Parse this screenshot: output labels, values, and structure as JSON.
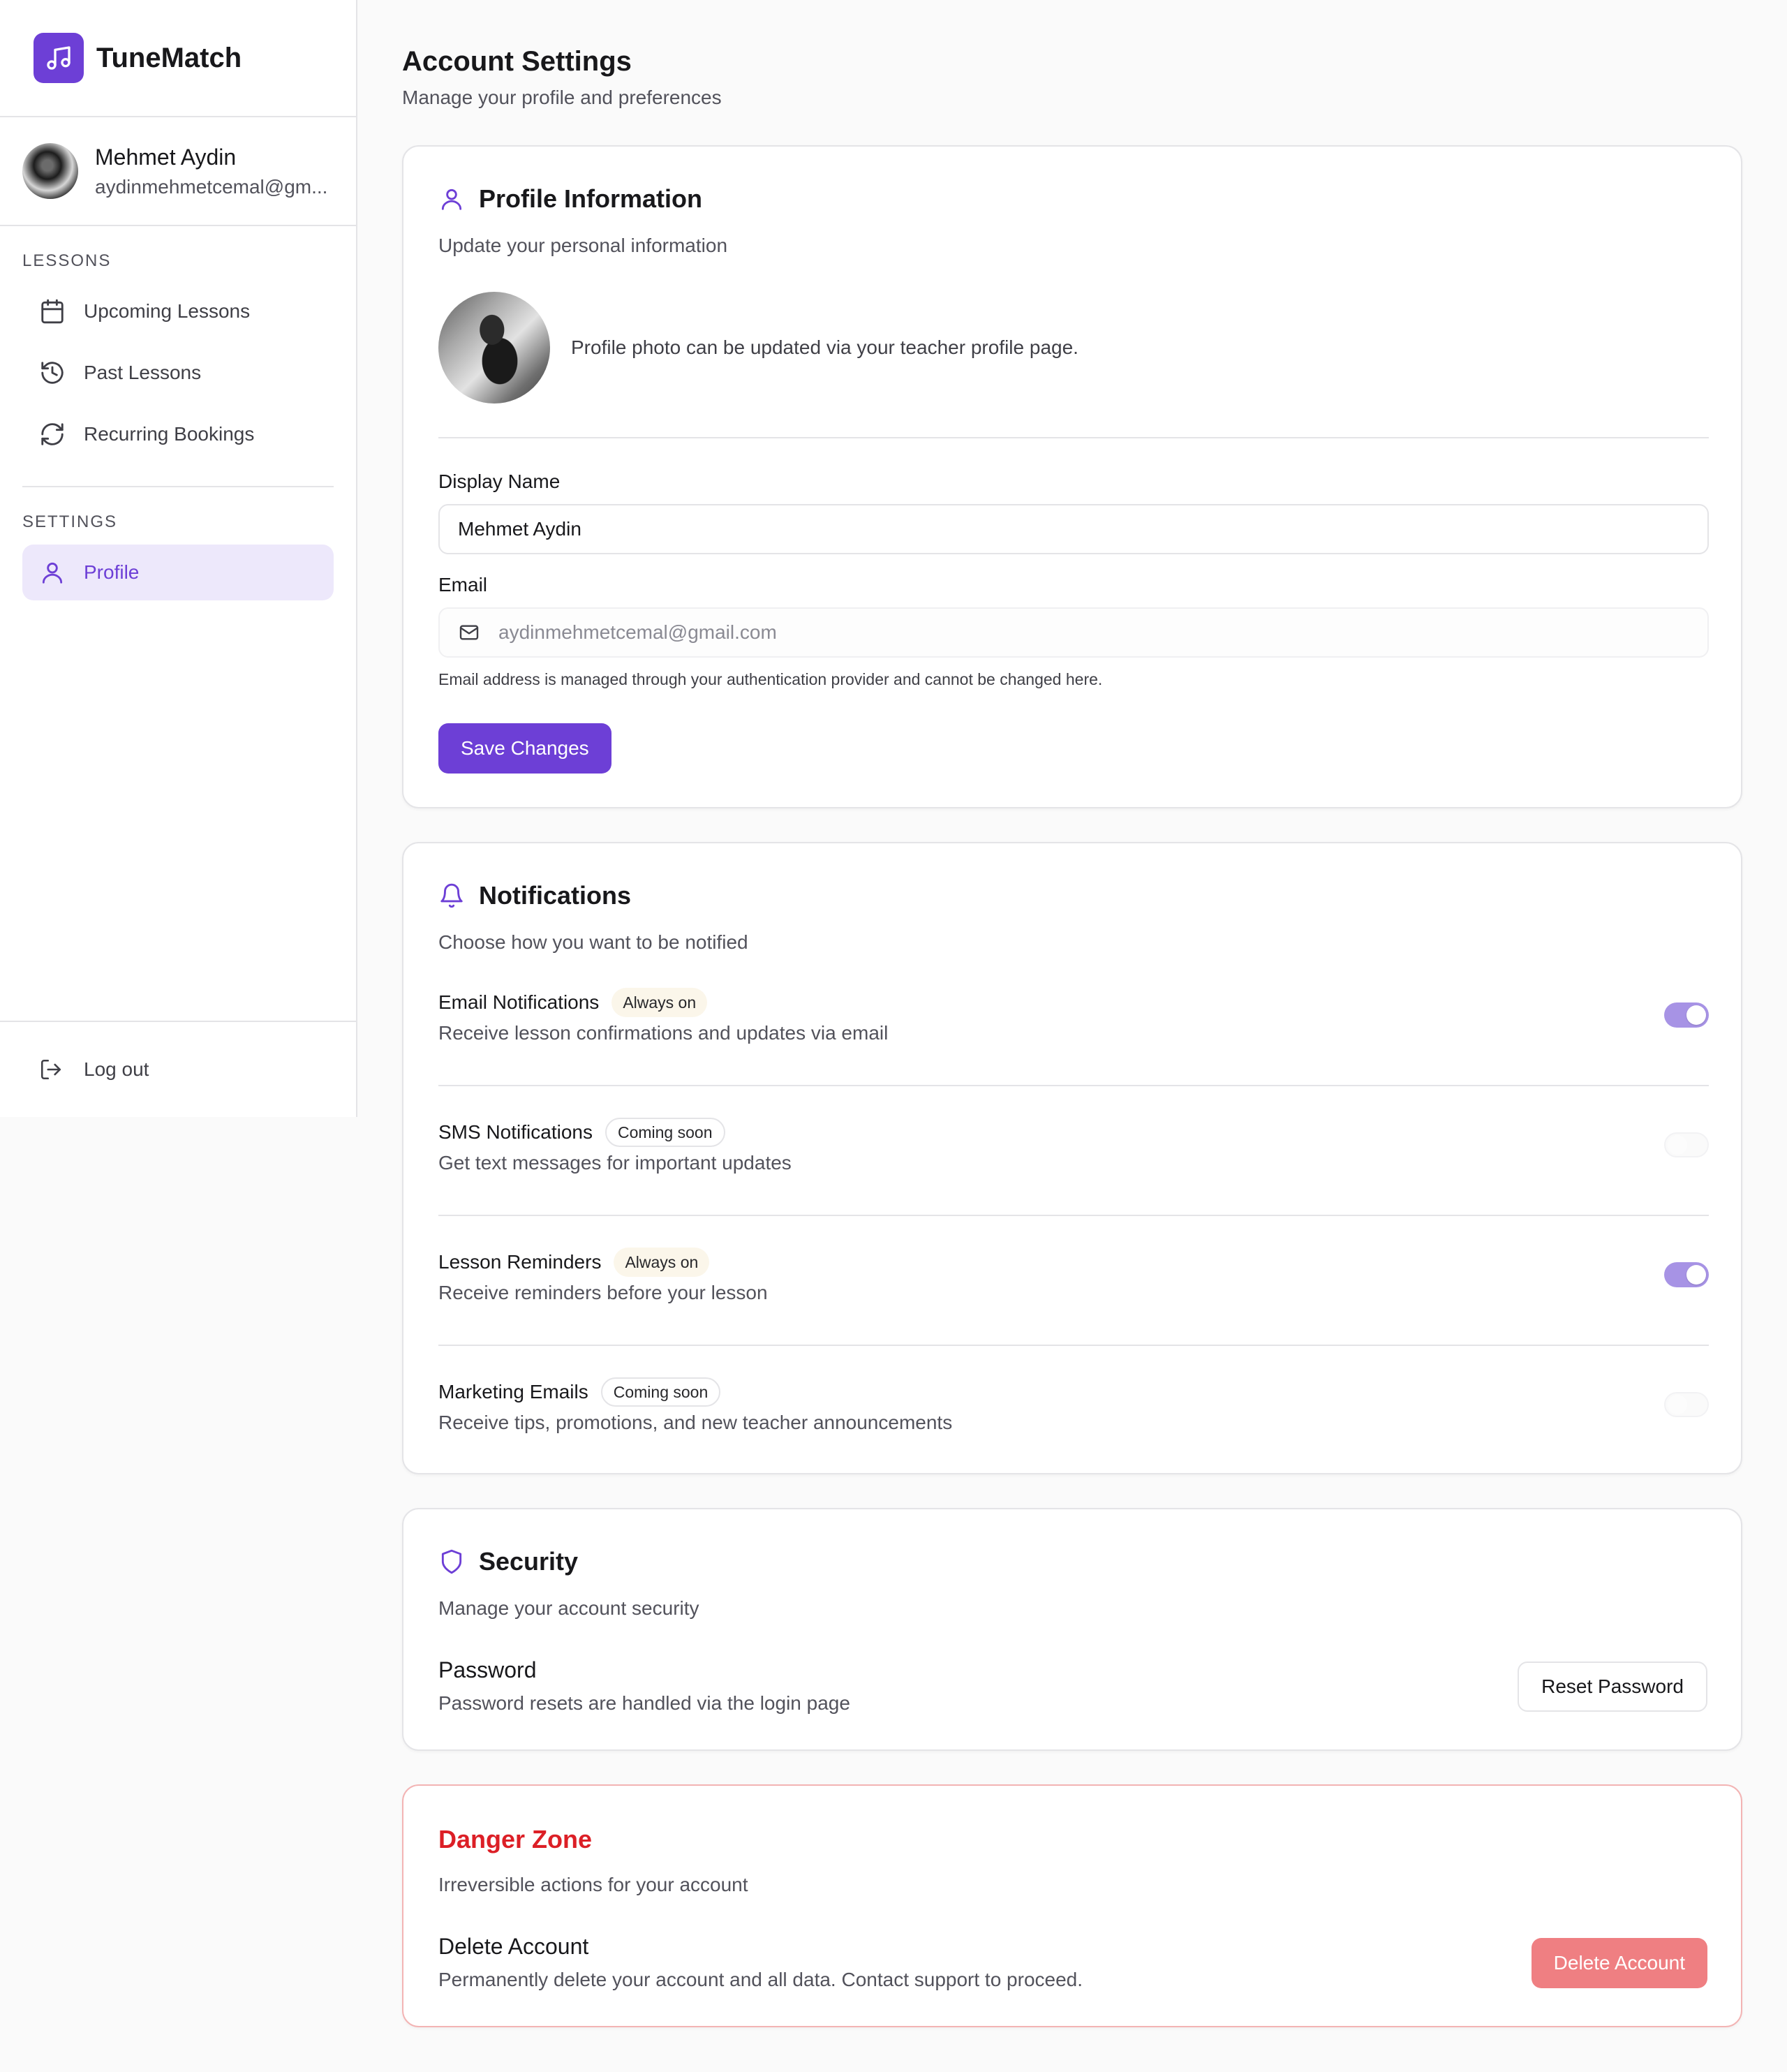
{
  "app": {
    "name": "TuneMatch",
    "accent": "#6d3fd6"
  },
  "user": {
    "name": "Mehmet Aydin",
    "email": "aydinmehmetcemal@gm..."
  },
  "sidebar": {
    "lessons_title": "LESSONS",
    "lessons": [
      {
        "label": "Upcoming Lessons",
        "icon": "calendar-icon"
      },
      {
        "label": "Past Lessons",
        "icon": "history-icon"
      },
      {
        "label": "Recurring Bookings",
        "icon": "refresh-icon"
      }
    ],
    "settings_title": "SETTINGS",
    "settings": [
      {
        "label": "Profile",
        "icon": "user-icon",
        "active": true
      }
    ],
    "logout": "Log out"
  },
  "page": {
    "title": "Account Settings",
    "subtitle": "Manage your profile and preferences"
  },
  "profile": {
    "title": "Profile Information",
    "subtitle": "Update your personal information",
    "photo_note": "Profile photo can be updated via your teacher profile page.",
    "display_name_label": "Display Name",
    "display_name_value": "Mehmet Aydin",
    "email_label": "Email",
    "email_value": "aydinmehmetcemal@gmail.com",
    "email_help": "Email address is managed through your authentication provider and cannot be changed here.",
    "save_label": "Save Changes"
  },
  "notifications": {
    "title": "Notifications",
    "subtitle": "Choose how you want to be notified",
    "items": [
      {
        "title": "Email Notifications",
        "badge": "Always on",
        "desc": "Receive lesson confirmations and updates via email",
        "enabled": true
      },
      {
        "title": "SMS Notifications",
        "badge": "Coming soon",
        "desc": "Get text messages for important updates",
        "enabled": false
      },
      {
        "title": "Lesson Reminders",
        "badge": "Always on",
        "desc": "Receive reminders before your lesson",
        "enabled": true
      },
      {
        "title": "Marketing Emails",
        "badge": "Coming soon",
        "desc": "Receive tips, promotions, and new teacher announcements",
        "enabled": false
      }
    ]
  },
  "security": {
    "title": "Security",
    "subtitle": "Manage your account security",
    "password_title": "Password",
    "password_desc": "Password resets are handled via the login page",
    "reset_label": "Reset Password"
  },
  "danger": {
    "title": "Danger Zone",
    "subtitle": "Irreversible actions for your account",
    "delete_title": "Delete Account",
    "delete_desc": "Permanently delete your account and all data. Contact support to proceed.",
    "delete_label": "Delete Account",
    "color": "#dc1f26"
  }
}
